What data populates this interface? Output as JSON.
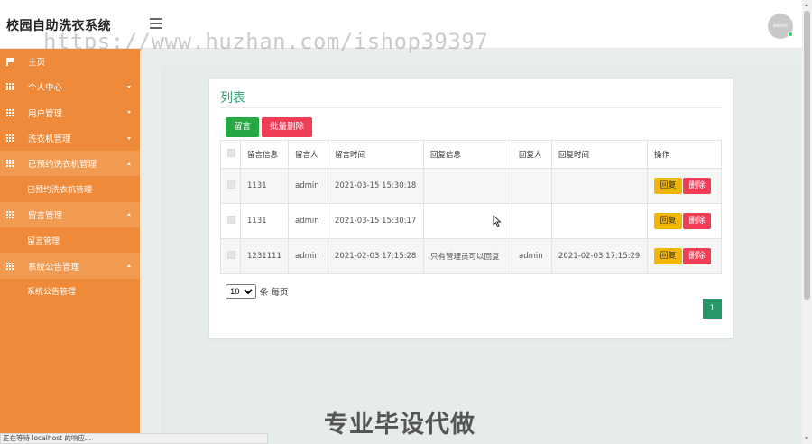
{
  "app": {
    "title": "校园自助洗衣系统",
    "watermark": "https://www.huzhan.com/ishop39397",
    "user_avatar_text": "admin"
  },
  "sidebar": {
    "items": [
      {
        "label": "主页",
        "icon": "flag-icon"
      },
      {
        "label": "个人中心",
        "icon": "grid-icon"
      },
      {
        "label": "用户管理",
        "icon": "grid-icon"
      },
      {
        "label": "洗衣机管理",
        "icon": "grid-icon"
      },
      {
        "label": "已预约洗衣机管理",
        "icon": "grid-icon",
        "sub": "已预约洗衣机管理"
      },
      {
        "label": "留言管理",
        "icon": "grid-icon",
        "sub": "留言管理"
      },
      {
        "label": "系统公告管理",
        "icon": "grid-icon",
        "sub": "系统公告管理"
      }
    ]
  },
  "card": {
    "title": "列表",
    "add_label": "留言",
    "batch_delete_label": "批量删除"
  },
  "table": {
    "headers": [
      "留言信息",
      "留言人",
      "留言时间",
      "回复信息",
      "回复人",
      "回复时间",
      "操作"
    ],
    "rows": [
      [
        "1131",
        "admin",
        "2021-03-15 15:30:18",
        "",
        "",
        ""
      ],
      [
        "1131",
        "admin",
        "2021-03-15 15:30:17",
        "",
        "",
        ""
      ],
      [
        "1231111",
        "admin",
        "2021-02-03 17:15:28",
        "只有管理员可以回复",
        "admin",
        "2021-02-03 17:15:29"
      ]
    ],
    "reply_label": "回复",
    "delete_label": "删除"
  },
  "pagination": {
    "page_size": "10",
    "page_size_suffix": "条 每页",
    "current_page": "1"
  },
  "slogan": "专业毕设代做",
  "status_bar": "正在等待 localhost 的响应..."
}
